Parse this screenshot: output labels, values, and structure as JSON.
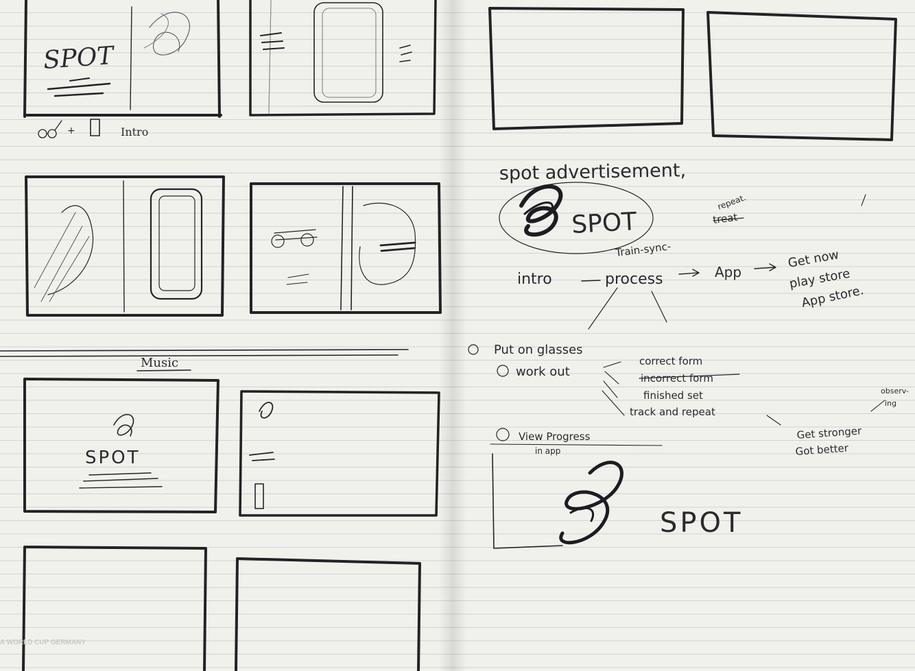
{
  "left_page": {
    "row1": {
      "logo_text": "SPOT",
      "caption_intro": "Intro"
    },
    "section_label": "Music",
    "row3": {
      "logo_text": "SPOT"
    },
    "footer_watermark": "A WORLD CUP GERMANY"
  },
  "right_page": {
    "heading": "spot advertisement,",
    "logo_text": "SPOT",
    "annotation_repeat": "repeat.",
    "annotation_train_sync": "Train-sync-",
    "annotation_struck": "treat",
    "flow": {
      "step1": "intro",
      "step2": "process",
      "step3": "App",
      "step4_line1": "Get now",
      "step4_line2": "play store",
      "step4_line3": "App store."
    },
    "list": {
      "item1": "Put on glasses",
      "item2": "work out",
      "item3_line1": "View Progress",
      "item3_line2": "in app",
      "sub1": "correct form",
      "sub2": "incorrect form",
      "sub3": "finished set",
      "sub4": "track and repeat"
    },
    "side_note_line1": "Get stronger",
    "side_note_line2": "Got better",
    "side_note_top": "observ-",
    "side_note_top2": "ing",
    "bottom_logo_text": "SPOT"
  }
}
